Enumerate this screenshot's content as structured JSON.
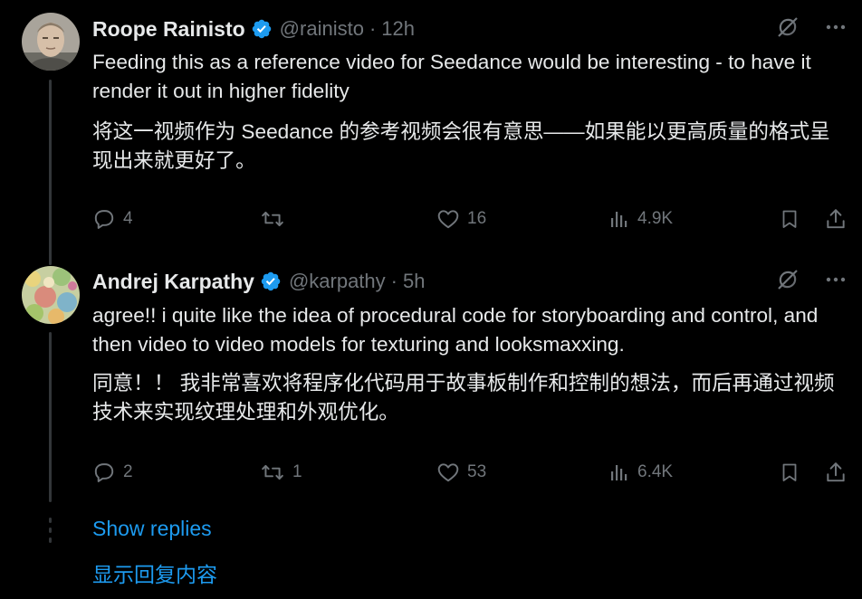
{
  "replies": [
    {
      "name": "Roope Rainisto",
      "handle": "@rainisto",
      "separator": "·",
      "time": "12h",
      "text_en": "Feeding this as a reference video for Seedance would be interesting - to have it render it out in higher fidelity",
      "text_zh": "将这一视频作为 Seedance 的参考视频会很有意思——如果能以更高质量的格式呈现出来就更好了。",
      "stats": {
        "replies": "4",
        "reposts": "",
        "likes": "16",
        "views": "4.9K"
      }
    },
    {
      "name": "Andrej Karpathy",
      "handle": "@karpathy",
      "separator": "·",
      "time": "5h",
      "text_en": "agree!! i quite like the idea of procedural code for storyboarding and control, and then video to video models for texturing and looksmaxxing.",
      "text_zh": "同意！！ 我非常喜欢将程序化代码用于故事板制作和控制的想法，而后再通过视频技术来实现纹理处理和外观优化。",
      "stats": {
        "replies": "2",
        "reposts": "1",
        "likes": "53",
        "views": "6.4K"
      }
    }
  ],
  "show_replies": {
    "label_en": "Show replies",
    "label_zh": "显示回复内容"
  },
  "colors": {
    "background": "#000000",
    "text": "#e7e9ea",
    "muted": "#71767b",
    "accent": "#1d9bf0"
  },
  "icons": [
    "verified-badge-icon",
    "grok-icon",
    "more-icon",
    "reply-icon",
    "repost-icon",
    "like-icon",
    "views-icon",
    "bookmark-icon",
    "share-icon"
  ]
}
